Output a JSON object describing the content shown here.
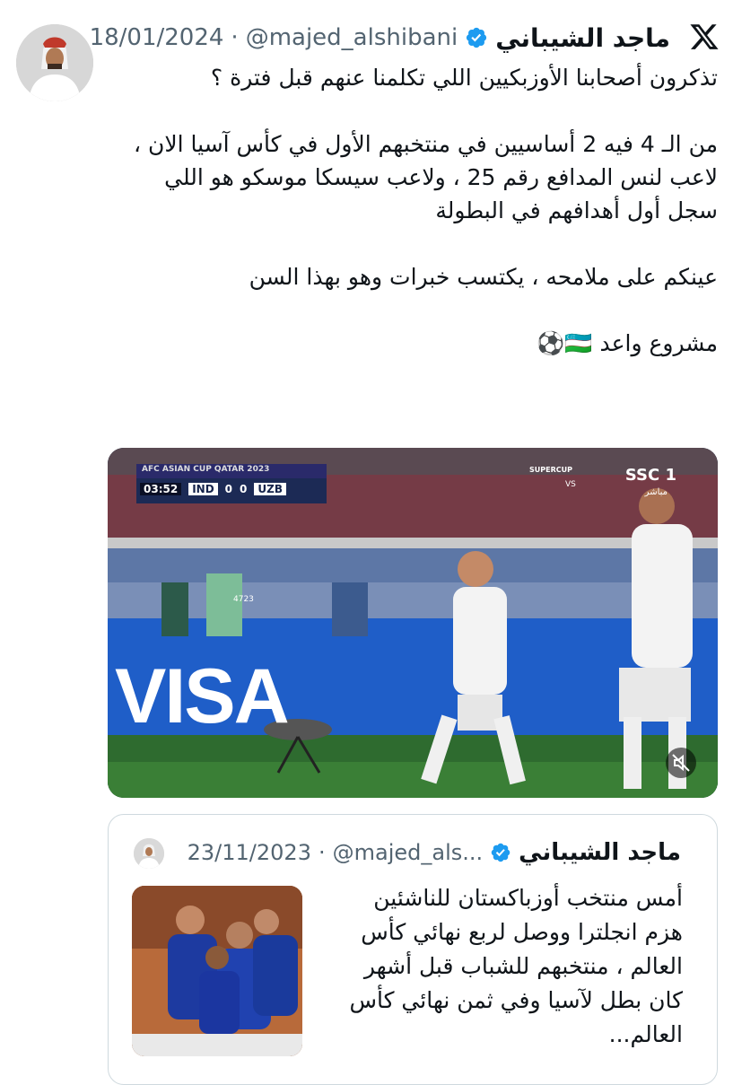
{
  "author": {
    "name": "ماجد الشيباني",
    "handle": "@majed_alshibani",
    "separator": "·",
    "date": "18/01/2024"
  },
  "tweet": {
    "lines": [
      "تذكرون أصحابنا الأوزبكيين اللي تكلمنا عنهم قبل فترة ؟",
      "",
      "من الـ 4 فيه 2 أساسيين في منتخبهم الأول في كأس آسيا الان ،",
      "لاعب لنس المدافع رقم 25 ، ولاعب سيسكا موسكو هو اللي",
      "سجل أول أهدافهم في البطولة",
      "",
      "عينكم على ملامحه ، يكتسب خبرات وهو بهذا السن",
      "",
      "مشروع واعد 🇺🇿⚽️"
    ]
  },
  "media": {
    "scoreboard": {
      "competition": "AFC ASIAN CUP QATAR 2023",
      "time": "03:52",
      "home": "IND",
      "home_score": "0",
      "away_score": "0",
      "away": "UZB"
    },
    "channel": "SSC 1",
    "channel_sub": "مباشر",
    "supercup": "SUPERCUP",
    "vs": "VS",
    "board_text": "VISA",
    "stand_number": "4723"
  },
  "quote": {
    "name": "ماجد الشيباني",
    "handle": "@majed_als...",
    "separator": "·",
    "date": "23/11/2023",
    "lines": [
      "أمس منتخب أوزباكستان للناشئين",
      "هزم انجلترا ووصل لربع نهائي كأس",
      "العالم ، منتخبهم للشباب قبل أشهر",
      "كان بطل لآسيا وفي ثمن نهائي كأس",
      "العالم..."
    ]
  },
  "colors": {
    "verified": "#1d9bf0",
    "meta": "#536471",
    "border": "#cfd9de"
  },
  "icons": {
    "x_logo": "x-logo-icon",
    "verified": "verified-badge-icon",
    "mute": "mute-icon"
  }
}
